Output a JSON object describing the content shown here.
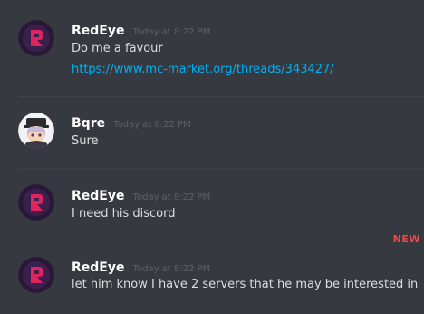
{
  "messages": [
    {
      "username": "RedEye",
      "timestamp": "Today at 8:22 PM",
      "text": "Do me a favour",
      "link": "https://www.mc-market.org/threads/343427/",
      "avatar": "redeye-logo-icon"
    },
    {
      "username": "Bqre",
      "timestamp": "Today at 8:22 PM",
      "text": "Sure",
      "avatar": "anime-character-avatar"
    },
    {
      "username": "RedEye",
      "timestamp": "Today at 8:22 PM",
      "text": "I need his discord",
      "avatar": "redeye-logo-icon"
    },
    {
      "username": "RedEye",
      "timestamp": "Today at 8:22 PM",
      "text": "let him know I have 2 servers that he may be interested in",
      "avatar": "redeye-logo-icon"
    }
  ],
  "new_divider_label": "NEW",
  "colors": {
    "background": "#36393f",
    "username": "#ffffff",
    "timestamp": "#5d6066",
    "text": "#dcddde",
    "link": "#00b0f4",
    "new_marker": "#f04747"
  }
}
